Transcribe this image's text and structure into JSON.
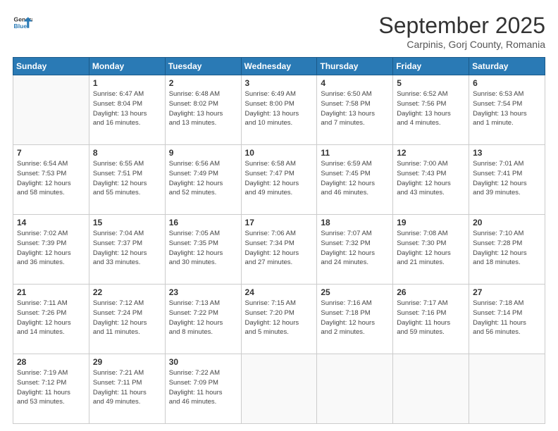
{
  "header": {
    "logo_line1": "General",
    "logo_line2": "Blue",
    "month": "September 2025",
    "location": "Carpinis, Gorj County, Romania"
  },
  "days_of_week": [
    "Sunday",
    "Monday",
    "Tuesday",
    "Wednesday",
    "Thursday",
    "Friday",
    "Saturday"
  ],
  "weeks": [
    [
      {
        "day": "",
        "info": ""
      },
      {
        "day": "1",
        "info": "Sunrise: 6:47 AM\nSunset: 8:04 PM\nDaylight: 13 hours\nand 16 minutes."
      },
      {
        "day": "2",
        "info": "Sunrise: 6:48 AM\nSunset: 8:02 PM\nDaylight: 13 hours\nand 13 minutes."
      },
      {
        "day": "3",
        "info": "Sunrise: 6:49 AM\nSunset: 8:00 PM\nDaylight: 13 hours\nand 10 minutes."
      },
      {
        "day": "4",
        "info": "Sunrise: 6:50 AM\nSunset: 7:58 PM\nDaylight: 13 hours\nand 7 minutes."
      },
      {
        "day": "5",
        "info": "Sunrise: 6:52 AM\nSunset: 7:56 PM\nDaylight: 13 hours\nand 4 minutes."
      },
      {
        "day": "6",
        "info": "Sunrise: 6:53 AM\nSunset: 7:54 PM\nDaylight: 13 hours\nand 1 minute."
      }
    ],
    [
      {
        "day": "7",
        "info": "Sunrise: 6:54 AM\nSunset: 7:53 PM\nDaylight: 12 hours\nand 58 minutes."
      },
      {
        "day": "8",
        "info": "Sunrise: 6:55 AM\nSunset: 7:51 PM\nDaylight: 12 hours\nand 55 minutes."
      },
      {
        "day": "9",
        "info": "Sunrise: 6:56 AM\nSunset: 7:49 PM\nDaylight: 12 hours\nand 52 minutes."
      },
      {
        "day": "10",
        "info": "Sunrise: 6:58 AM\nSunset: 7:47 PM\nDaylight: 12 hours\nand 49 minutes."
      },
      {
        "day": "11",
        "info": "Sunrise: 6:59 AM\nSunset: 7:45 PM\nDaylight: 12 hours\nand 46 minutes."
      },
      {
        "day": "12",
        "info": "Sunrise: 7:00 AM\nSunset: 7:43 PM\nDaylight: 12 hours\nand 43 minutes."
      },
      {
        "day": "13",
        "info": "Sunrise: 7:01 AM\nSunset: 7:41 PM\nDaylight: 12 hours\nand 39 minutes."
      }
    ],
    [
      {
        "day": "14",
        "info": "Sunrise: 7:02 AM\nSunset: 7:39 PM\nDaylight: 12 hours\nand 36 minutes."
      },
      {
        "day": "15",
        "info": "Sunrise: 7:04 AM\nSunset: 7:37 PM\nDaylight: 12 hours\nand 33 minutes."
      },
      {
        "day": "16",
        "info": "Sunrise: 7:05 AM\nSunset: 7:35 PM\nDaylight: 12 hours\nand 30 minutes."
      },
      {
        "day": "17",
        "info": "Sunrise: 7:06 AM\nSunset: 7:34 PM\nDaylight: 12 hours\nand 27 minutes."
      },
      {
        "day": "18",
        "info": "Sunrise: 7:07 AM\nSunset: 7:32 PM\nDaylight: 12 hours\nand 24 minutes."
      },
      {
        "day": "19",
        "info": "Sunrise: 7:08 AM\nSunset: 7:30 PM\nDaylight: 12 hours\nand 21 minutes."
      },
      {
        "day": "20",
        "info": "Sunrise: 7:10 AM\nSunset: 7:28 PM\nDaylight: 12 hours\nand 18 minutes."
      }
    ],
    [
      {
        "day": "21",
        "info": "Sunrise: 7:11 AM\nSunset: 7:26 PM\nDaylight: 12 hours\nand 14 minutes."
      },
      {
        "day": "22",
        "info": "Sunrise: 7:12 AM\nSunset: 7:24 PM\nDaylight: 12 hours\nand 11 minutes."
      },
      {
        "day": "23",
        "info": "Sunrise: 7:13 AM\nSunset: 7:22 PM\nDaylight: 12 hours\nand 8 minutes."
      },
      {
        "day": "24",
        "info": "Sunrise: 7:15 AM\nSunset: 7:20 PM\nDaylight: 12 hours\nand 5 minutes."
      },
      {
        "day": "25",
        "info": "Sunrise: 7:16 AM\nSunset: 7:18 PM\nDaylight: 12 hours\nand 2 minutes."
      },
      {
        "day": "26",
        "info": "Sunrise: 7:17 AM\nSunset: 7:16 PM\nDaylight: 11 hours\nand 59 minutes."
      },
      {
        "day": "27",
        "info": "Sunrise: 7:18 AM\nSunset: 7:14 PM\nDaylight: 11 hours\nand 56 minutes."
      }
    ],
    [
      {
        "day": "28",
        "info": "Sunrise: 7:19 AM\nSunset: 7:12 PM\nDaylight: 11 hours\nand 53 minutes."
      },
      {
        "day": "29",
        "info": "Sunrise: 7:21 AM\nSunset: 7:11 PM\nDaylight: 11 hours\nand 49 minutes."
      },
      {
        "day": "30",
        "info": "Sunrise: 7:22 AM\nSunset: 7:09 PM\nDaylight: 11 hours\nand 46 minutes."
      },
      {
        "day": "",
        "info": ""
      },
      {
        "day": "",
        "info": ""
      },
      {
        "day": "",
        "info": ""
      },
      {
        "day": "",
        "info": ""
      }
    ]
  ]
}
